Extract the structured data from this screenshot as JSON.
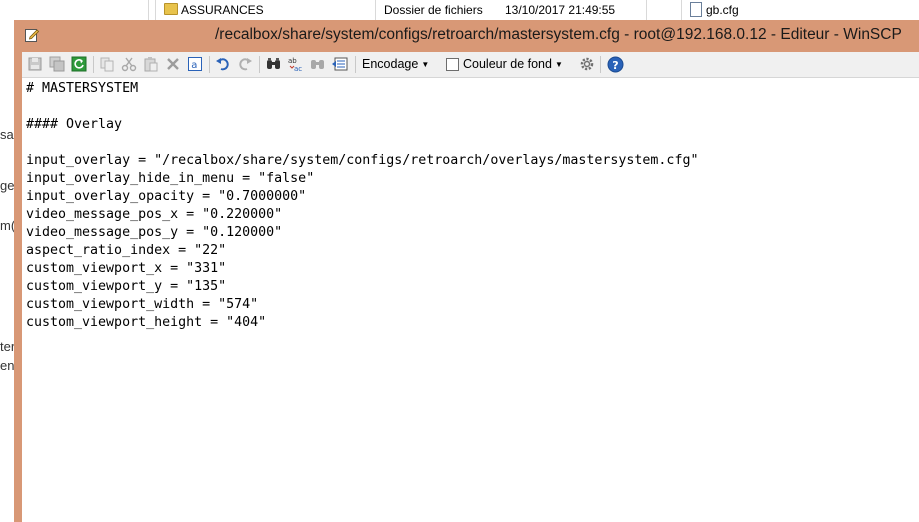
{
  "background_explorer": {
    "folder_name": "ASSURANCES",
    "folder_type": "Dossier de fichiers",
    "folder_date": "13/10/2017  21:49:55",
    "file_name": "gb.cfg",
    "side_fragments": [
      "sar",
      "ge",
      "m(",
      "ter",
      "en"
    ]
  },
  "editor": {
    "title": "/recalbox/share/system/configs/retroarch/mastersystem.cfg - root@192.168.0.12 - Editeur - WinSCP",
    "toolbar": {
      "encoding_label": "Encodage",
      "background_color_label": "Couleur de fond"
    },
    "lines": [
      "# MASTERSYSTEM",
      "",
      "#### Overlay",
      "",
      "input_overlay = \"/recalbox/share/system/configs/retroarch/overlays/mastersystem.cfg\"",
      "input_overlay_hide_in_menu = \"false\"",
      "input_overlay_opacity = \"0.7000000\"",
      "video_message_pos_x = \"0.220000\"",
      "video_message_pos_y = \"0.120000\"",
      "aspect_ratio_index = \"22\"",
      "custom_viewport_x = \"331\"",
      "custom_viewport_y = \"135\"",
      "custom_viewport_width = \"574\"",
      "custom_viewport_height = \"404\""
    ]
  },
  "colors": {
    "title_bar": "#d89876",
    "toolbar_bg": "#f0f0f0",
    "editor_bg": "#ffffff"
  }
}
